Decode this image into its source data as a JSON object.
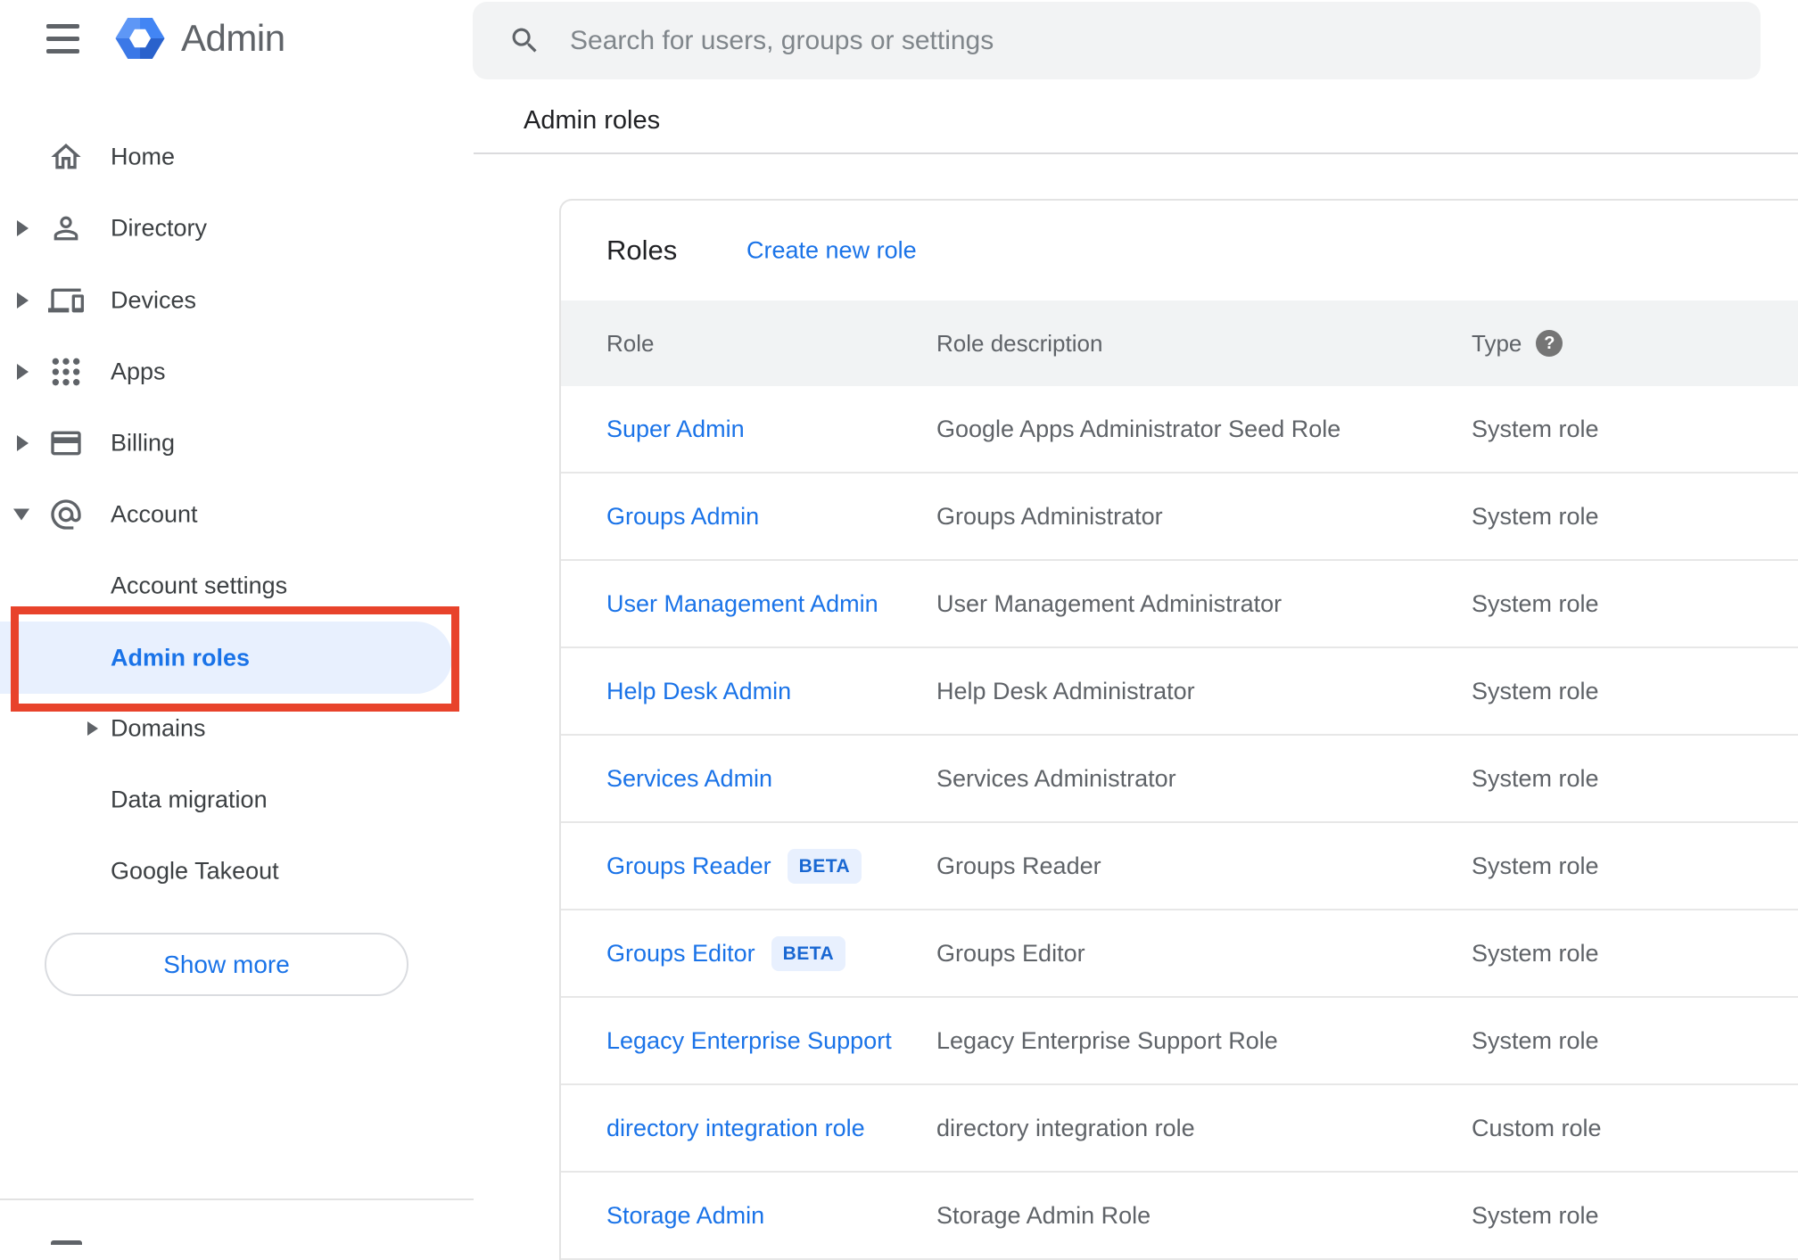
{
  "app": {
    "name": "Admin"
  },
  "search": {
    "placeholder": "Search for users, groups or settings"
  },
  "page": {
    "breadcrumb": "Admin roles"
  },
  "sidebar": {
    "items": [
      {
        "label": "Home"
      },
      {
        "label": "Directory"
      },
      {
        "label": "Devices"
      },
      {
        "label": "Apps"
      },
      {
        "label": "Billing"
      },
      {
        "label": "Account"
      }
    ],
    "account_children": [
      {
        "label": "Account settings"
      },
      {
        "label": "Admin roles",
        "selected": true
      },
      {
        "label": "Domains"
      },
      {
        "label": "Data migration"
      },
      {
        "label": "Google Takeout"
      }
    ],
    "show_more": "Show more"
  },
  "roles_panel": {
    "title": "Roles",
    "create_new_role": "Create new role",
    "help_glyph": "?",
    "columns": {
      "role": "Role",
      "description": "Role description",
      "type": "Type"
    },
    "rows": [
      {
        "role": "Super Admin",
        "description": "Google Apps Administrator Seed Role",
        "type": "System role"
      },
      {
        "role": "Groups Admin",
        "description": "Groups Administrator",
        "type": "System role"
      },
      {
        "role": "User Management Admin",
        "description": "User Management Administrator",
        "type": "System role"
      },
      {
        "role": "Help Desk Admin",
        "description": "Help Desk Administrator",
        "type": "System role"
      },
      {
        "role": "Services Admin",
        "description": "Services Administrator",
        "type": "System role"
      },
      {
        "role": "Groups Reader",
        "badge": "BETA",
        "description": "Groups Reader",
        "type": "System role"
      },
      {
        "role": "Groups Editor",
        "badge": "BETA",
        "description": "Groups Editor",
        "type": "System role"
      },
      {
        "role": "Legacy Enterprise Support",
        "description": "Legacy Enterprise Support Role",
        "type": "System role"
      },
      {
        "role": "directory integration role",
        "description": "directory integration role",
        "type": "Custom role"
      },
      {
        "role": "Storage Admin",
        "description": "Storage Admin Role",
        "type": "System role"
      }
    ]
  },
  "annotation": {
    "highlighted_item": "Admin roles",
    "color": "#e8432b"
  },
  "colors": {
    "accent_blue": "#1a73e8",
    "selected_item_bg": "#e8f0fe",
    "annotation_red": "#e8432b",
    "badge_bg": "#e8f0fe",
    "badge_text": "#1967d2",
    "text_primary": "#202124",
    "text_secondary": "#5f6368",
    "divider": "#dadce0",
    "table_header_bg": "#f1f3f4",
    "search_bg": "#f2f3f4"
  }
}
